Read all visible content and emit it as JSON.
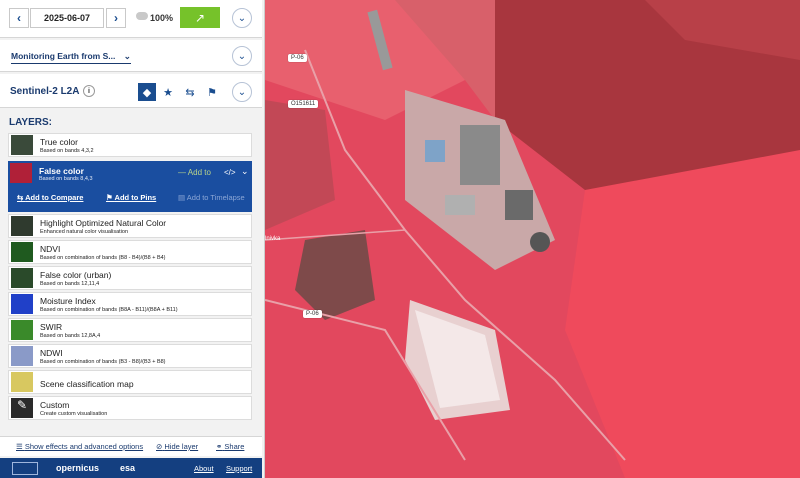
{
  "datebar": {
    "prev_icon": "chevron-left-icon",
    "date": "2025-06-07",
    "next_icon": "chevron-right-icon",
    "cloud_icon": "cloud-icon",
    "cloud_coverage": "100%",
    "go_icon": "arrow-up-right-icon",
    "go_color": "#76c22a",
    "collapse_icon": "chevron-down-icon"
  },
  "theme": {
    "label": "Monitoring Earth from S...",
    "dropdown_icon": "chevron-down-icon"
  },
  "dataset": {
    "title": "Sentinel-2 L2A",
    "info_icon": "info-icon",
    "tabs": [
      "layers-icon",
      "star-icon",
      "compare-icon",
      "pin-icon"
    ]
  },
  "layers_heading": "LAYERS:",
  "layers": [
    {
      "title": "True color",
      "sub": "Based on bands 4,3,2",
      "thumb": "#3a4a3a"
    },
    {
      "title": "False color",
      "sub": "Based on bands 8,4,3",
      "thumb": "#b02038",
      "active": true
    },
    {
      "title": "Highlight Optimized Natural Color",
      "sub": "Enhanced natural color visualisation",
      "thumb": "#2f3a2e"
    },
    {
      "title": "NDVI",
      "sub": "Based on combination of bands (B8 - B4)/(B8 + B4)",
      "thumb": "#1f5a1f"
    },
    {
      "title": "False color (urban)",
      "sub": "Based on bands 12,11,4",
      "thumb": "#2a4a2a"
    },
    {
      "title": "Moisture Index",
      "sub": "Based on combination of bands (B8A - B11)/(B8A + B11)",
      "thumb": "#2040c8"
    },
    {
      "title": "SWIR",
      "sub": "Based on bands 12,8A,4",
      "thumb": "#3a8a2a"
    },
    {
      "title": "NDWI",
      "sub": "Based on combination of bands (B3 - B8)/(B3 + B8)",
      "thumb": "#8a9ac8"
    },
    {
      "title": "Scene classification map",
      "sub": "",
      "thumb": "#d8c860"
    },
    {
      "title": "Custom",
      "sub": "Create custom visualisation",
      "thumb": "#2a2a2a"
    }
  ],
  "active_layer": {
    "add_to": "Add to",
    "add_to_compare": "Add to Compare",
    "add_to_pins": "Add to Pins",
    "add_to_timelapse": "Add to Timelapse"
  },
  "footer": {
    "effects": "Show effects and advanced options",
    "hide_layer": "Hide layer",
    "share": "Share"
  },
  "logos": {
    "copernicus": "opernicus",
    "esa": "esa",
    "about": "About",
    "support": "Support"
  },
  "map": {
    "road_labels": [
      "P-06",
      "O151611",
      "P-06"
    ],
    "place_label": "lnivka"
  }
}
